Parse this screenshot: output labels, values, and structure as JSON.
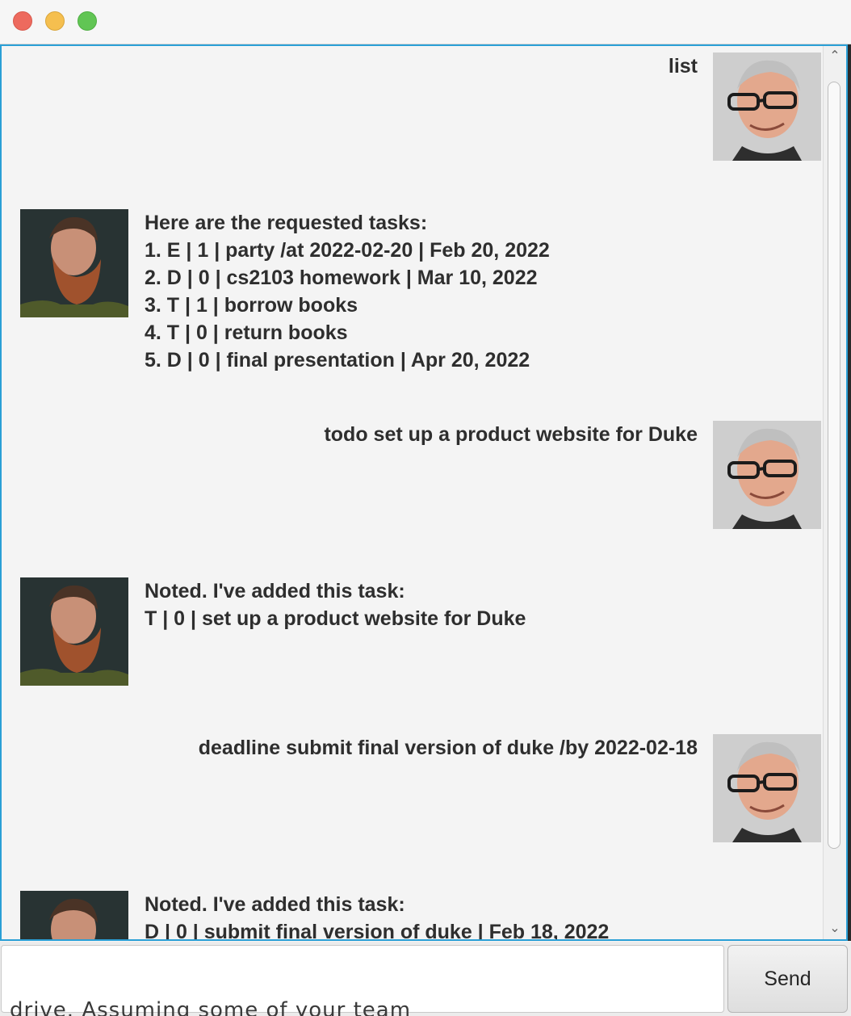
{
  "window": {
    "buttons": [
      "close",
      "minimize",
      "maximize"
    ]
  },
  "conversation": [
    {
      "speaker": "user",
      "avatar": "user-avatar",
      "text": "list"
    },
    {
      "speaker": "duke",
      "avatar": "duke-avatar",
      "text": "Here are the requested tasks:\n1. E | 1 | party /at 2022-02-20 | Feb 20, 2022\n2. D | 0 | cs2103 homework | Mar 10, 2022\n3. T | 1 | borrow books\n4. T | 0 | return books\n5. D | 0 | final presentation | Apr 20, 2022"
    },
    {
      "speaker": "user",
      "avatar": "user-avatar",
      "text": "todo set up a product website for Duke"
    },
    {
      "speaker": "duke",
      "avatar": "duke-avatar",
      "text": "Noted. I've added this task:\nT | 0 | set up a product website for Duke"
    },
    {
      "speaker": "user",
      "avatar": "user-avatar",
      "text": "deadline submit final version of duke /by 2022-02-18"
    },
    {
      "speaker": "duke",
      "avatar": "duke-avatar",
      "text": "Noted. I've added this task:\nD | 0 | submit final version of duke | Feb 18, 2022"
    }
  ],
  "input": {
    "value": "",
    "placeholder": ""
  },
  "send_button": {
    "label": "Send"
  },
  "background_text": "drive. Assuming some of your team",
  "colors": {
    "focus_border": "#2a9fd6",
    "close": "#ed6a5e",
    "minimize": "#f5bf4f",
    "maximize": "#61c554"
  }
}
